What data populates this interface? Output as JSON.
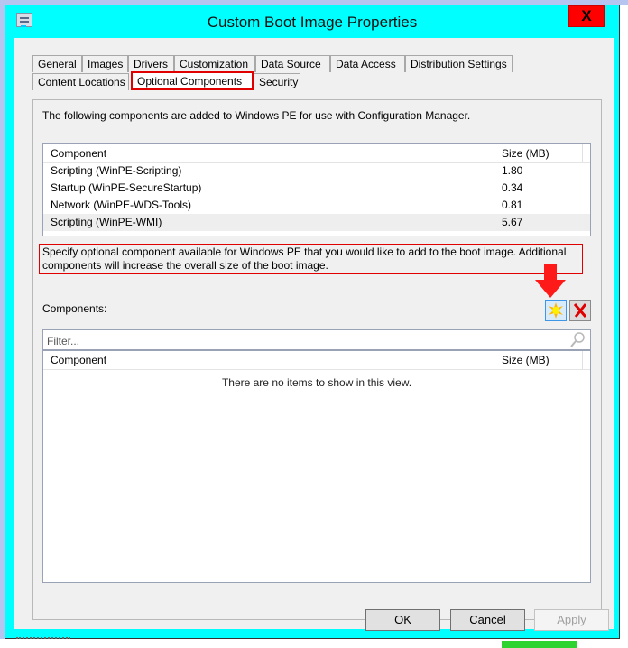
{
  "window": {
    "title": "Custom Boot Image Properties",
    "close_label": "X"
  },
  "tabs": {
    "row1": [
      {
        "label": "General"
      },
      {
        "label": "Images"
      },
      {
        "label": "Drivers"
      },
      {
        "label": "Customization"
      },
      {
        "label": "Data Source"
      },
      {
        "label": "Data Access"
      },
      {
        "label": "Distribution Settings"
      }
    ],
    "row2": [
      {
        "label": "Content Locations"
      },
      {
        "label": "Optional Components",
        "active": true
      },
      {
        "label": "Security"
      }
    ]
  },
  "page": {
    "intro": "The following components are added to Windows PE for use with Configuration Manager.",
    "installed_list": {
      "columns": [
        "Component",
        "Size (MB)"
      ],
      "rows": [
        {
          "component": "Scripting (WinPE-Scripting)",
          "size": "1.80"
        },
        {
          "component": "Startup (WinPE-SecureStartup)",
          "size": "0.34"
        },
        {
          "component": "Network (WinPE-WDS-Tools)",
          "size": "0.81"
        },
        {
          "component": "Scripting (WinPE-WMI)",
          "size": "5.67",
          "selected": true
        }
      ]
    },
    "hint": "Specify optional component available for Windows PE that you would like to add to the boot image. Additional components will increase the overall size of the boot image.",
    "components_label": "Components:",
    "add_icon": "starburst-add-icon",
    "delete_icon": "red-x-delete-icon",
    "filter": {
      "placeholder": "Filter...",
      "value": ""
    },
    "components_list": {
      "columns": [
        "Component",
        "Size (MB)"
      ],
      "empty_text": "There are no items to show in this view."
    }
  },
  "buttons": {
    "ok": "OK",
    "cancel": "Cancel",
    "apply": "Apply"
  },
  "colors": {
    "title_bar": "#00ffff",
    "highlight": "#e00000"
  }
}
